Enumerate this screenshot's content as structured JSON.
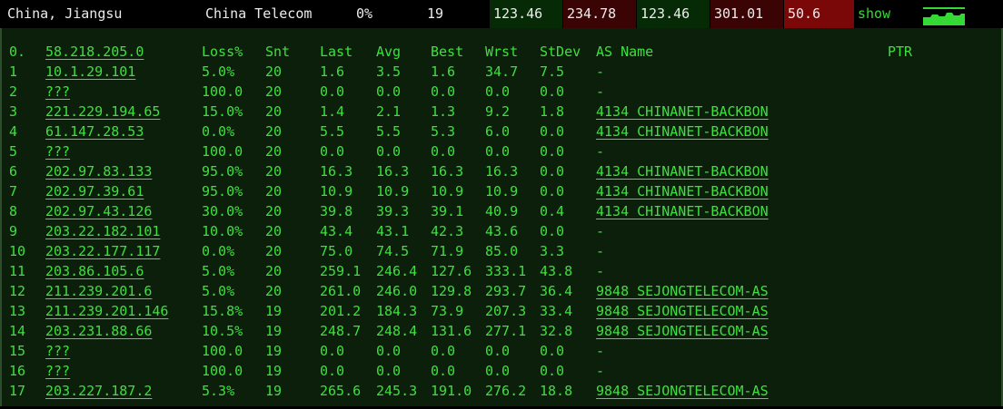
{
  "summary": {
    "location": "China, Jiangsu",
    "isp": "China Telecom",
    "loss": "0%",
    "sent": "19",
    "last": "123.46",
    "avg": "234.78",
    "best": "123.46",
    "worst": "301.01",
    "stdev": "50.6",
    "show_label": "show",
    "colors": {
      "good": "#062a06",
      "bad": "#3a0404",
      "worse": "#7a0808",
      "accent": "#35d935"
    }
  },
  "mtr": {
    "headers": {
      "idx": "0.",
      "host": "58.218.205.0",
      "loss": "Loss%",
      "snt": "Snt",
      "last": "Last",
      "avg": "Avg",
      "best": "Best",
      "wrst": "Wrst",
      "stdev": "StDev",
      "as": "AS Name",
      "ptr": "PTR"
    },
    "rows": [
      {
        "idx": "1",
        "host": "10.1.29.101",
        "loss": "5.0%",
        "snt": "20",
        "last": "1.6",
        "avg": "3.5",
        "best": "1.6",
        "wrst": "34.7",
        "stdev": "7.5",
        "as": "-",
        "as_link": false
      },
      {
        "idx": "2",
        "host": "???",
        "loss": "100.0",
        "snt": "20",
        "last": "0.0",
        "avg": "0.0",
        "best": "0.0",
        "wrst": "0.0",
        "stdev": "0.0",
        "as": "-",
        "as_link": false
      },
      {
        "idx": "3",
        "host": "221.229.194.65",
        "loss": "15.0%",
        "snt": "20",
        "last": "1.4",
        "avg": "2.1",
        "best": "1.3",
        "wrst": "9.2",
        "stdev": "1.8",
        "as": "4134  CHINANET-BACKBON",
        "as_link": true
      },
      {
        "idx": "4",
        "host": "61.147.28.53",
        "loss": "0.0%",
        "snt": "20",
        "last": "5.5",
        "avg": "5.5",
        "best": "5.3",
        "wrst": "6.0",
        "stdev": "0.0",
        "as": "4134  CHINANET-BACKBON",
        "as_link": true
      },
      {
        "idx": "5",
        "host": "???",
        "loss": "100.0",
        "snt": "20",
        "last": "0.0",
        "avg": "0.0",
        "best": "0.0",
        "wrst": "0.0",
        "stdev": "0.0",
        "as": "-",
        "as_link": false
      },
      {
        "idx": "6",
        "host": "202.97.83.133",
        "loss": "95.0%",
        "snt": "20",
        "last": "16.3",
        "avg": "16.3",
        "best": "16.3",
        "wrst": "16.3",
        "stdev": "0.0",
        "as": "4134  CHINANET-BACKBON",
        "as_link": true
      },
      {
        "idx": "7",
        "host": "202.97.39.61",
        "loss": "95.0%",
        "snt": "20",
        "last": "10.9",
        "avg": "10.9",
        "best": "10.9",
        "wrst": "10.9",
        "stdev": "0.0",
        "as": "4134  CHINANET-BACKBON",
        "as_link": true
      },
      {
        "idx": "8",
        "host": "202.97.43.126",
        "loss": "30.0%",
        "snt": "20",
        "last": "39.8",
        "avg": "39.3",
        "best": "39.1",
        "wrst": "40.9",
        "stdev": "0.4",
        "as": "4134  CHINANET-BACKBON",
        "as_link": true
      },
      {
        "idx": "9",
        "host": "203.22.182.101",
        "loss": "10.0%",
        "snt": "20",
        "last": "43.4",
        "avg": "43.1",
        "best": "42.3",
        "wrst": "43.6",
        "stdev": "0.0",
        "as": "-",
        "as_link": false
      },
      {
        "idx": "10",
        "host": "203.22.177.117",
        "loss": "0.0%",
        "snt": "20",
        "last": "75.0",
        "avg": "74.5",
        "best": "71.9",
        "wrst": "85.0",
        "stdev": "3.3",
        "as": "-",
        "as_link": false
      },
      {
        "idx": "11",
        "host": "203.86.105.6",
        "loss": "5.0%",
        "snt": "20",
        "last": "259.1",
        "avg": "246.4",
        "best": "127.6",
        "wrst": "333.1",
        "stdev": "43.8",
        "as": "-",
        "as_link": false
      },
      {
        "idx": "12",
        "host": "211.239.201.6",
        "loss": "5.0%",
        "snt": "20",
        "last": "261.0",
        "avg": "246.0",
        "best": "129.8",
        "wrst": "293.7",
        "stdev": "36.4",
        "as": "9848  SEJONGTELECOM-AS",
        "as_link": true
      },
      {
        "idx": "13",
        "host": "211.239.201.146",
        "loss": "15.8%",
        "snt": "19",
        "last": "201.2",
        "avg": "184.3",
        "best": "73.9",
        "wrst": "207.3",
        "stdev": "33.4",
        "as": "9848  SEJONGTELECOM-AS",
        "as_link": true
      },
      {
        "idx": "14",
        "host": "203.231.88.66",
        "loss": "10.5%",
        "snt": "19",
        "last": "248.7",
        "avg": "248.4",
        "best": "131.6",
        "wrst": "277.1",
        "stdev": "32.8",
        "as": "9848  SEJONGTELECOM-AS",
        "as_link": true
      },
      {
        "idx": "15",
        "host": "???",
        "loss": "100.0",
        "snt": "19",
        "last": "0.0",
        "avg": "0.0",
        "best": "0.0",
        "wrst": "0.0",
        "stdev": "0.0",
        "as": "-",
        "as_link": false
      },
      {
        "idx": "16",
        "host": "???",
        "loss": "100.0",
        "snt": "19",
        "last": "0.0",
        "avg": "0.0",
        "best": "0.0",
        "wrst": "0.0",
        "stdev": "0.0",
        "as": "-",
        "as_link": false
      },
      {
        "idx": "17",
        "host": "203.227.187.2",
        "loss": "5.3%",
        "snt": "19",
        "last": "265.6",
        "avg": "245.3",
        "best": "191.0",
        "wrst": "276.2",
        "stdev": "18.8",
        "as": "9848  SEJONGTELECOM-AS",
        "as_link": true
      }
    ],
    "colors": {
      "text": "#3ee03e",
      "panel_bg": "#0b1f0b"
    }
  }
}
